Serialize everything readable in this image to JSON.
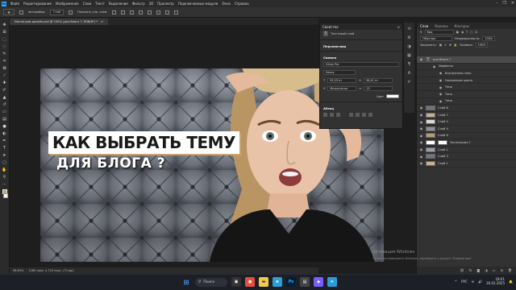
{
  "menubar": {
    "app_logo": "Ps",
    "items": [
      "Файл",
      "Редактирование",
      "Изображение",
      "Слои",
      "Текст",
      "Выделение",
      "Фильтр",
      "3D",
      "Просмотр",
      "Подключаемые модули",
      "Окно",
      "Справка"
    ],
    "window_controls": [
      "–",
      "❐",
      "✕"
    ]
  },
  "options": {
    "autoselect": "Автовыбор:",
    "target": "Слой",
    "show_controls": "Показать упр. элем."
  },
  "tools": [
    "move-tool",
    "artboard-tool",
    "marquee-tool",
    "lasso-tool",
    "quick-select-tool",
    "crop-tool",
    "frame-tool",
    "eyedropper-tool",
    "healing-tool",
    "brush-tool",
    "stamp-tool",
    "history-brush-tool",
    "eraser-tool",
    "gradient-tool",
    "blur-tool",
    "dodge-tool",
    "pen-tool",
    "type-tool",
    "path-select-tool",
    "shape-tool",
    "hand-tool",
    "zoom-tool",
    "more-tool"
  ],
  "tab": {
    "title": "Инстаграм дизайн.psd @ 100% (для блога ?, RGB/8*) *",
    "close": "×"
  },
  "artwork": {
    "line1": "КАК ВЫБРАТЬ ТЕМУ",
    "line2": "ДЛЯ БЛОГА ?",
    "colors": {
      "background": "#8a8f9a",
      "accent": "#caa36b"
    }
  },
  "status": {
    "zoom": "98,63%",
    "doc_size": "1280 пикс. x 720 пикс. (72 ppi)"
  },
  "properties": {
    "title": "Свойства",
    "layer_type": "Текстовый слой",
    "transform_label": "Перспектива",
    "character_label": "Символ",
    "font": "Gilroy Pro",
    "font_style": "Heavy",
    "size": "93,33 пт",
    "leading": "96,41 пт",
    "kerning": "Метрически",
    "tracking": "25",
    "color_label": "Цвет",
    "paragraph_label": "Абзац"
  },
  "layers_panel": {
    "tabs": [
      "Слои",
      "Каналы",
      "Контуры"
    ],
    "active_tab": 0,
    "filter": "Вид",
    "blend": "Обычные",
    "opacity_label": "Непрозрачность:",
    "opacity": "100%",
    "lock_label": "Закрепить:",
    "fill_label": "Заливка:",
    "fill": "100%",
    "rows": [
      {
        "name": "для блога ?",
        "kind": "text",
        "selected": true,
        "indent": 0
      },
      {
        "name": "Эффекты",
        "kind": "fx",
        "selected": false,
        "indent": 1
      },
      {
        "name": "Внутренняя тень",
        "kind": "fx",
        "selected": false,
        "indent": 2
      },
      {
        "name": "Наложение цвета",
        "kind": "fx",
        "selected": false,
        "indent": 2
      },
      {
        "name": "Тень",
        "kind": "fx",
        "selected": false,
        "indent": 2
      },
      {
        "name": "Тень",
        "kind": "fx",
        "selected": false,
        "indent": 2
      },
      {
        "name": "Тень",
        "kind": "fx",
        "selected": false,
        "indent": 2
      },
      {
        "name": "Слой 8",
        "kind": "image",
        "selected": false,
        "indent": 0
      },
      {
        "name": "Слой 7",
        "kind": "image",
        "selected": false,
        "indent": 0
      },
      {
        "name": "Слой 5",
        "kind": "image",
        "selected": false,
        "indent": 0
      },
      {
        "name": "Слой 4",
        "kind": "image",
        "selected": false,
        "indent": 0
      },
      {
        "name": "Слой 6",
        "kind": "image",
        "selected": false,
        "indent": 0
      },
      {
        "name": "Экспозиция 1",
        "kind": "adjust",
        "selected": false,
        "indent": 0
      },
      {
        "name": "Слой 2",
        "kind": "image",
        "selected": false,
        "indent": 0
      },
      {
        "name": "Слой 3",
        "kind": "image",
        "selected": false,
        "indent": 0
      },
      {
        "name": "Слой 1",
        "kind": "image",
        "selected": false,
        "indent": 0
      }
    ]
  },
  "watermark": {
    "line1": "Активация Windows",
    "line2": "Чтобы активировать Windows, перейдите в раздел \"Параметры\"."
  },
  "taskbar": {
    "search": "Поиск",
    "lang": "РУС",
    "time": "18:01",
    "date": "16.01.2025"
  }
}
